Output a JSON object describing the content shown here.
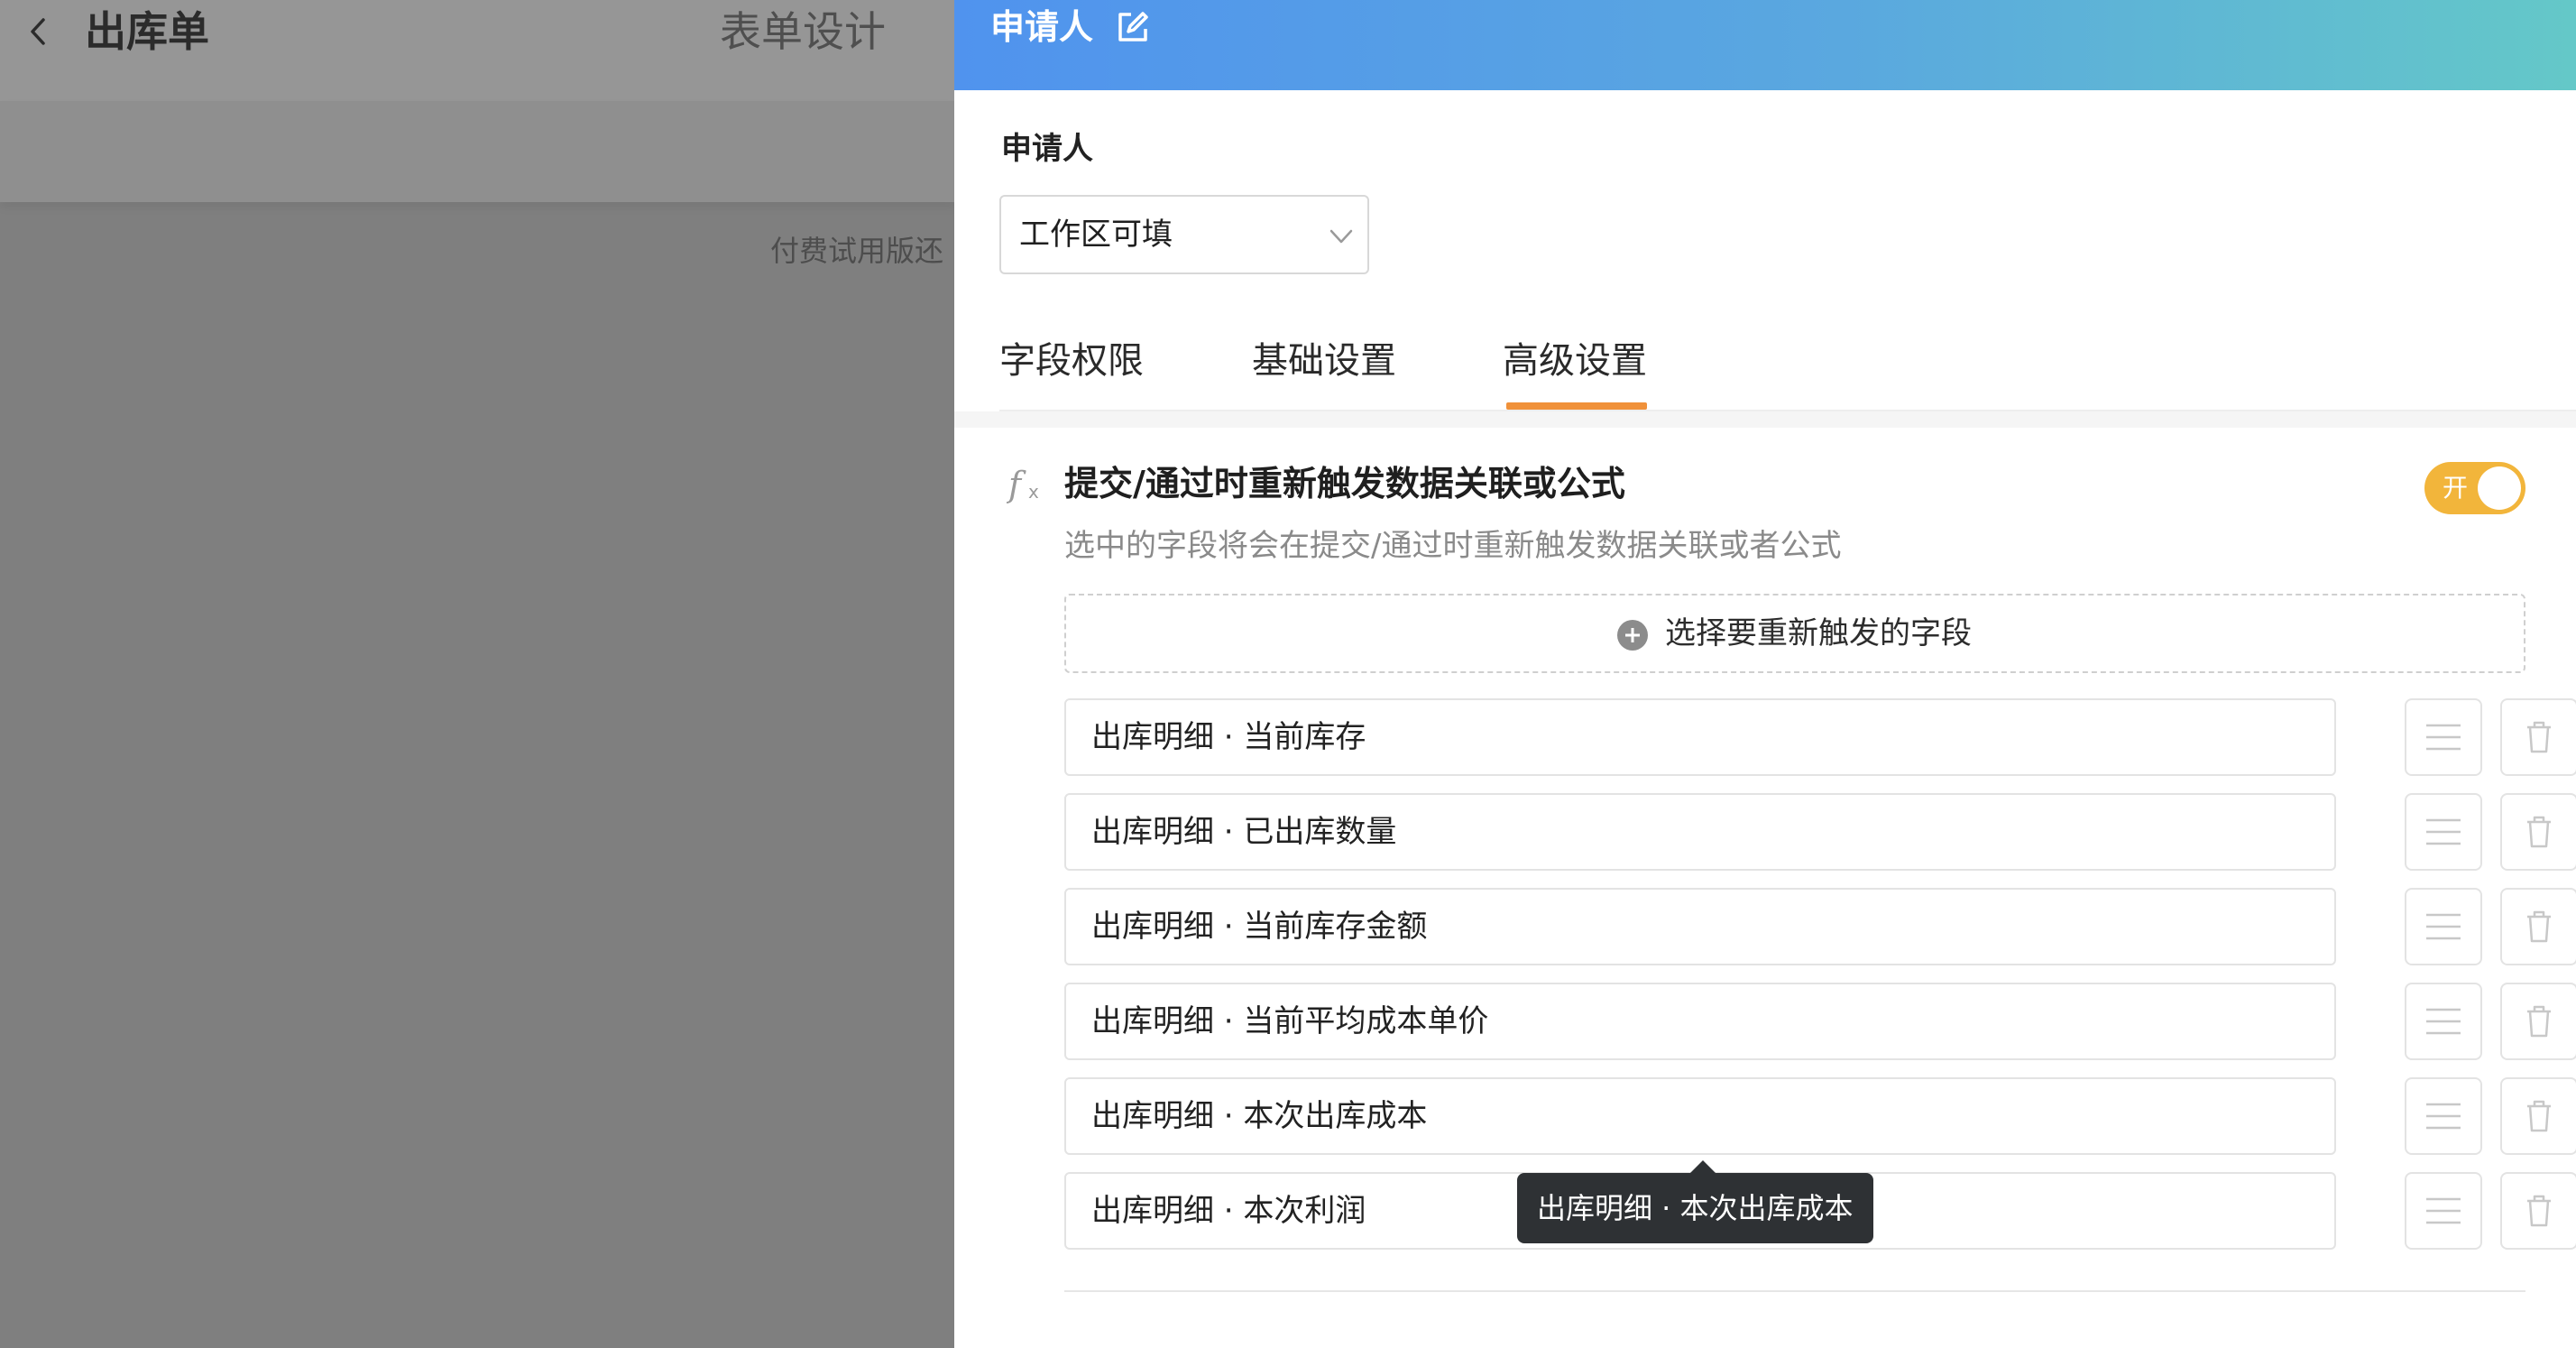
{
  "background": {
    "title": "出库单",
    "design_label": "表单设计",
    "trial_notice": "付费试用版还"
  },
  "drawer": {
    "title": "申请人",
    "field_label": "申请人",
    "permission": {
      "value": "工作区可填"
    },
    "tabs": [
      {
        "label": "字段权限",
        "active": false
      },
      {
        "label": "基础设置",
        "active": false
      },
      {
        "label": "高级设置",
        "active": true
      }
    ],
    "section": {
      "icon": "fx-icon",
      "title": "提交/通过时重新触发数据关联或公式",
      "description": "选中的字段将会在提交/通过时重新触发数据关联或者公式",
      "toggle": {
        "label": "开",
        "on": true
      },
      "select_button_label": "选择要重新触发的字段",
      "fields": [
        {
          "label": "出库明细 · 当前库存"
        },
        {
          "label": "出库明细 · 已出库数量"
        },
        {
          "label": "出库明细 · 当前库存金额"
        },
        {
          "label": "出库明细 · 当前平均成本单价"
        },
        {
          "label": "出库明细 · 本次出库成本"
        },
        {
          "label": "出库明细 · 本次利润"
        }
      ]
    },
    "tooltip": {
      "text": "出库明细 · 本次出库成本"
    }
  },
  "colors": {
    "accent_orange": "#f0913a",
    "toggle_on": "#f2b53b",
    "header_gradient_start": "#5093ee",
    "header_gradient_end": "#64c8c8"
  }
}
